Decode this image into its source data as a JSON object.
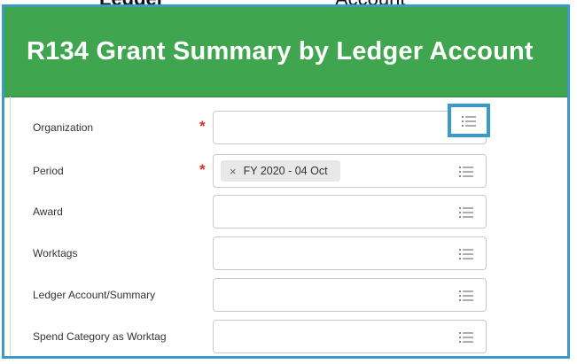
{
  "header_fragment": {
    "left": "Ledger",
    "right": "Account"
  },
  "report": {
    "title": "R134 Grant Summary by Ledger Account"
  },
  "form": {
    "fields": [
      {
        "label": "Organization",
        "required": true,
        "value": "",
        "icon": "prompt-list-icon"
      },
      {
        "label": "Period",
        "required": true,
        "value": "FY 2020 - 04 Oct",
        "icon": "prompt-list-icon"
      },
      {
        "label": "Award",
        "required": false,
        "value": "",
        "icon": "prompt-list-icon"
      },
      {
        "label": "Worktags",
        "required": false,
        "value": "",
        "icon": "prompt-list-icon"
      },
      {
        "label": "Ledger Account/Summary",
        "required": false,
        "value": "",
        "icon": "prompt-list-icon"
      },
      {
        "label": "Spend Category as Worktag",
        "required": false,
        "value": "",
        "icon": "prompt-list-icon"
      }
    ],
    "required_mark": "*",
    "remove_glyph": "×"
  },
  "colors": {
    "banner": "#3fa64f",
    "highlight": "#3a9bc8",
    "required": "#d93025"
  }
}
